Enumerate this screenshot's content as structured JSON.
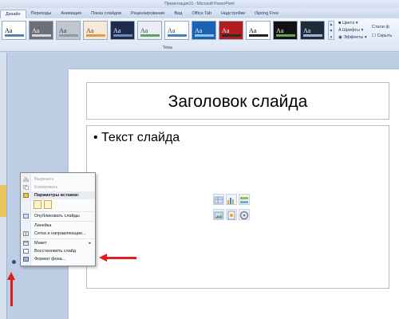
{
  "window": {
    "title": "Презентация10 - Microsoft PowerPoint"
  },
  "tabs": [
    "Дизайн",
    "Переходы",
    "Анимация",
    "Показ слайдов",
    "Рецензирование",
    "Вид",
    "Office Tab",
    "Надстройки",
    "iSpring Free"
  ],
  "ribbon": {
    "group_label": "Темы",
    "theme_sample": "Aa",
    "themes": [
      {
        "bg": "#ffffff",
        "fg": "#000000",
        "bar": "#4f81bd"
      },
      {
        "bg": "#6a6f7a",
        "fg": "#ffffff",
        "bar": "#d8d8d8"
      },
      {
        "bg": "#bfc6cf",
        "fg": "#333333",
        "bar": "#8f9aa8"
      },
      {
        "bg": "#f7ead8",
        "fg": "#5a3b1b",
        "bar": "#e09a47"
      },
      {
        "bg": "#1e2b4a",
        "fg": "#ffffff",
        "bar": "#6f86c2"
      },
      {
        "bg": "#e9eef4",
        "fg": "#1f3a5f",
        "bar": "#5fa05f"
      },
      {
        "bg": "#ffffff",
        "fg": "#1f3a5f",
        "bar": "#3b83c7"
      },
      {
        "bg": "#1a62b5",
        "fg": "#ffffff",
        "bar": "#8fc4f0"
      },
      {
        "bg": "#b21e1e",
        "fg": "#ffffff",
        "bar": "#2b2b2b"
      },
      {
        "bg": "#ffffff",
        "fg": "#000000",
        "bar": "#222222"
      },
      {
        "bg": "#111111",
        "fg": "#ffffff",
        "bar": "#6aa84f"
      },
      {
        "bg": "#1d2b3a",
        "fg": "#ffffff",
        "bar": "#9fb5d3"
      }
    ],
    "options": [
      "Цвета",
      "Шрифты",
      "Эффекты"
    ],
    "options2": [
      "Стили ф",
      "Скрыть"
    ]
  },
  "slide": {
    "title": "Заголовок слайда",
    "bullet": "Текст слайда"
  },
  "context_menu": {
    "items": [
      {
        "label": "Вырезать",
        "disabled": true
      },
      {
        "label": "Копировать",
        "disabled": true
      },
      {
        "label": "Параметры вставки:",
        "header": true
      },
      {
        "label": "Опубликовать слайды"
      },
      {
        "label": "Линейка"
      },
      {
        "label": "Сетка и направляющие..."
      },
      {
        "label": "Макет",
        "submenu": true
      },
      {
        "label": "Восстановить слайд"
      },
      {
        "label": "Формат фона..."
      }
    ]
  },
  "colors": {
    "annotation_arrow": "#e21b1b"
  }
}
